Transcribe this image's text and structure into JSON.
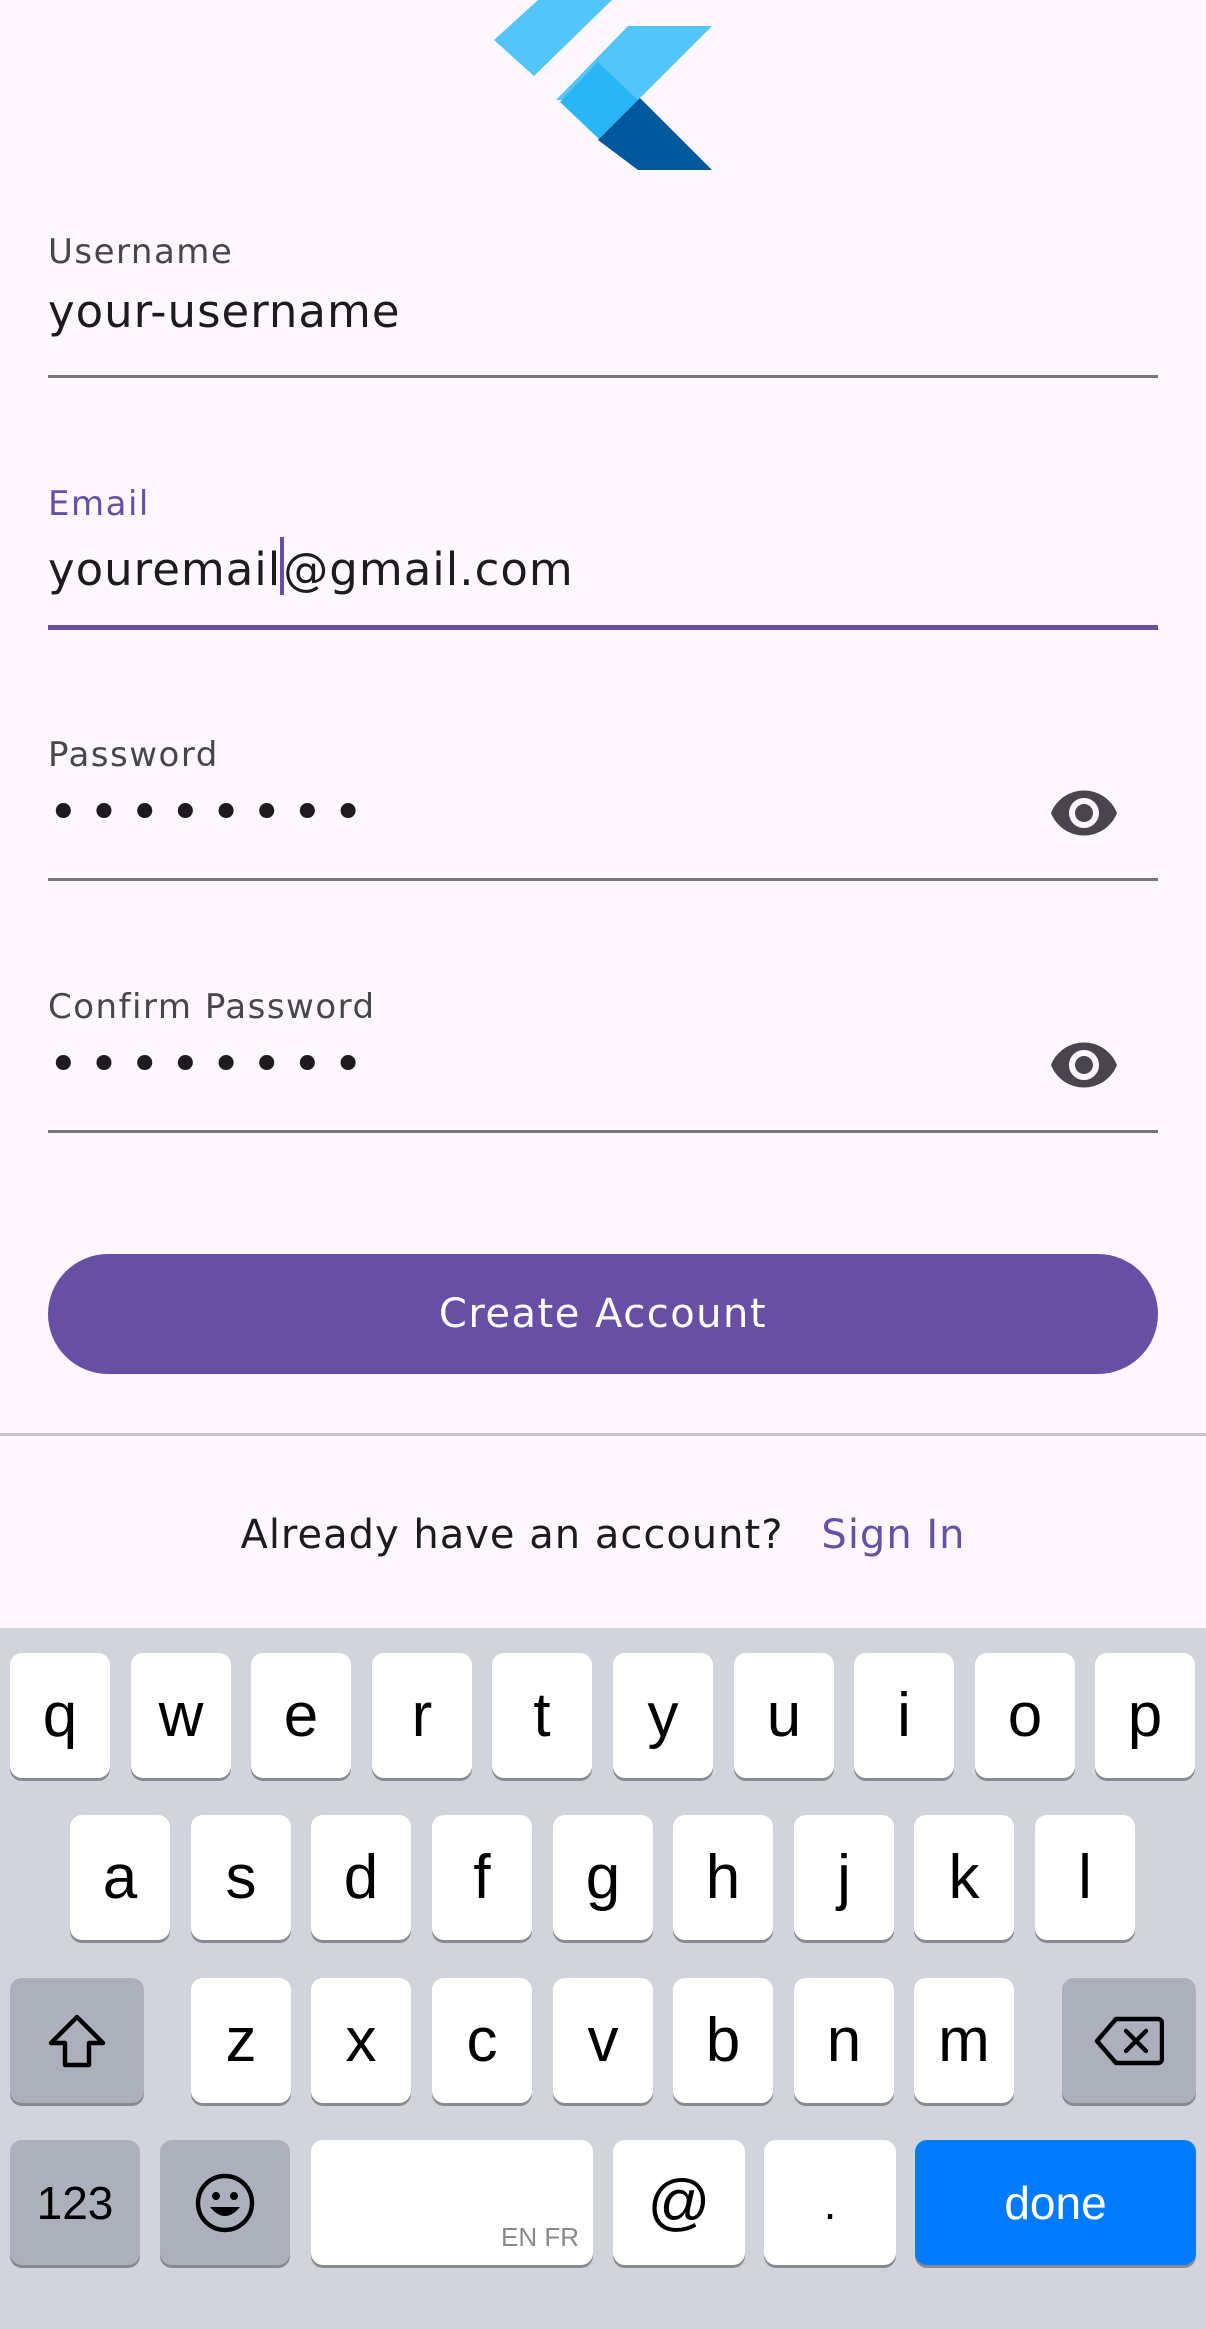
{
  "form": {
    "username": {
      "label": "Username",
      "value": "your-username"
    },
    "email": {
      "label": "Email",
      "value_before_cursor": "youremail",
      "value_after_cursor": "@gmail.com"
    },
    "password": {
      "label": "Password",
      "value": "••••••••"
    },
    "confirm_password": {
      "label": "Confirm Password",
      "value": "••••••••"
    },
    "visibility_icon": "eye-icon",
    "create_button_label": "Create Account"
  },
  "signin": {
    "question": "Already have an account?",
    "link_label": "Sign In"
  },
  "keyboard": {
    "row1": [
      "q",
      "w",
      "e",
      "r",
      "t",
      "y",
      "u",
      "i",
      "o",
      "p"
    ],
    "row2": [
      "a",
      "s",
      "d",
      "f",
      "g",
      "h",
      "j",
      "k",
      "l"
    ],
    "row3": [
      "z",
      "x",
      "c",
      "v",
      "b",
      "n",
      "m"
    ],
    "numbers_label": "123",
    "space_lang": "EN FR",
    "at_label": "@",
    "period_label": ".",
    "done_label": "done"
  },
  "colors": {
    "primary": "#6750a4",
    "background": "#fef7ff",
    "done_key": "#007aff",
    "logo_light": "#54c5f8",
    "logo_mid": "#29b6f6",
    "logo_dark": "#01579b"
  }
}
